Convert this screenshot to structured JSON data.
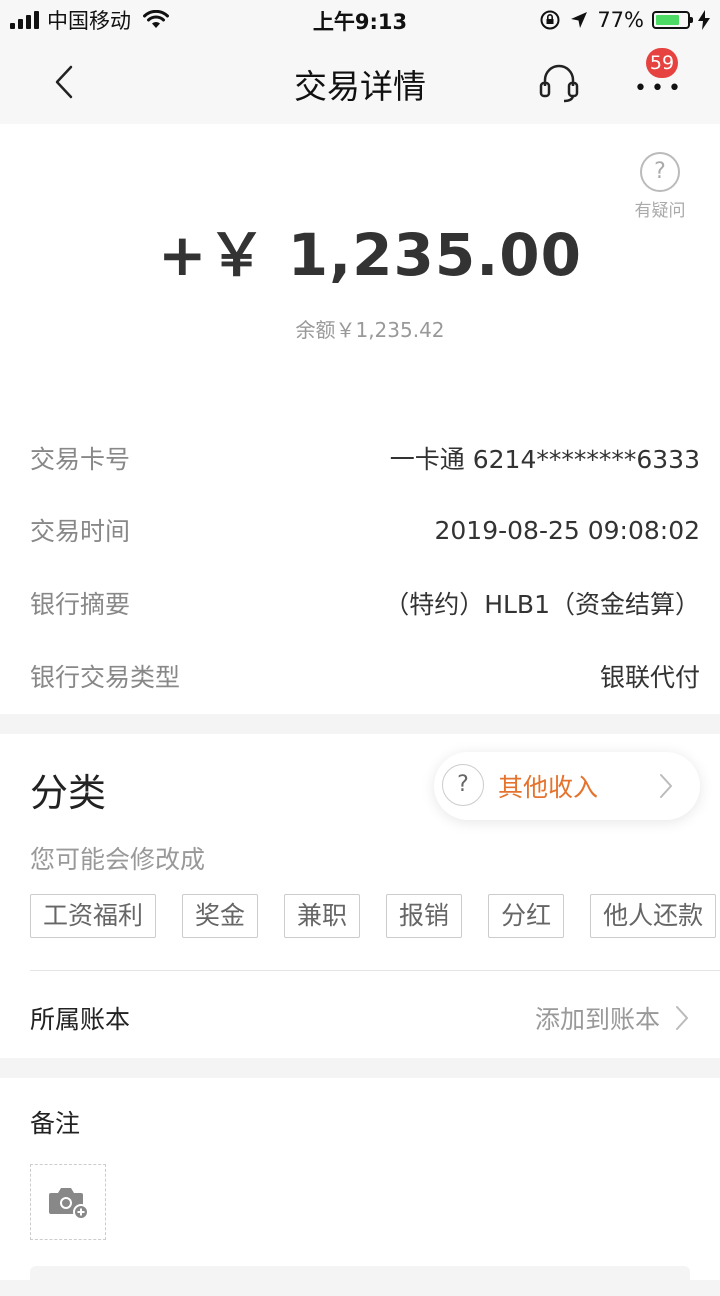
{
  "status_bar": {
    "carrier": "中国移动",
    "time": "上午9:13",
    "battery_percent": "77%",
    "battery_level": 0.77,
    "icons": [
      "signal-icon",
      "wifi-icon",
      "orientation-lock-icon",
      "location-icon",
      "battery-icon",
      "charging-icon"
    ]
  },
  "nav": {
    "title": "交易详情",
    "back_icon": "chevron-left-icon",
    "headset_icon": "headset-icon",
    "more_icon": "more-icon",
    "badge": "59"
  },
  "help": {
    "label": "有疑问",
    "icon": "?"
  },
  "transaction": {
    "amount": "+￥ 1,235.00",
    "balance": "余额￥1,235.42",
    "rows": [
      {
        "label": "交易卡号",
        "value": "一卡通 6214********6333"
      },
      {
        "label": "交易时间",
        "value": "2019-08-25 09:08:02"
      },
      {
        "label": "银行摘要",
        "value": "（特约）HLB1（资金结算）"
      },
      {
        "label": "银行交易类型",
        "value": "银联代付"
      }
    ]
  },
  "category": {
    "title": "分类",
    "current": "其他收入",
    "help_icon": "?",
    "suggest_label": "您可能会修改成",
    "tags": [
      "工资福利",
      "奖金",
      "兼职",
      "报销",
      "分红",
      "他人还款"
    ]
  },
  "ledger": {
    "label": "所属账本",
    "value": "添加到账本"
  },
  "note": {
    "title": "备注",
    "photo_icon": "camera-add-icon"
  },
  "colors": {
    "accent": "#e5732d",
    "badge": "#e64340",
    "battery": "#4cd964"
  }
}
